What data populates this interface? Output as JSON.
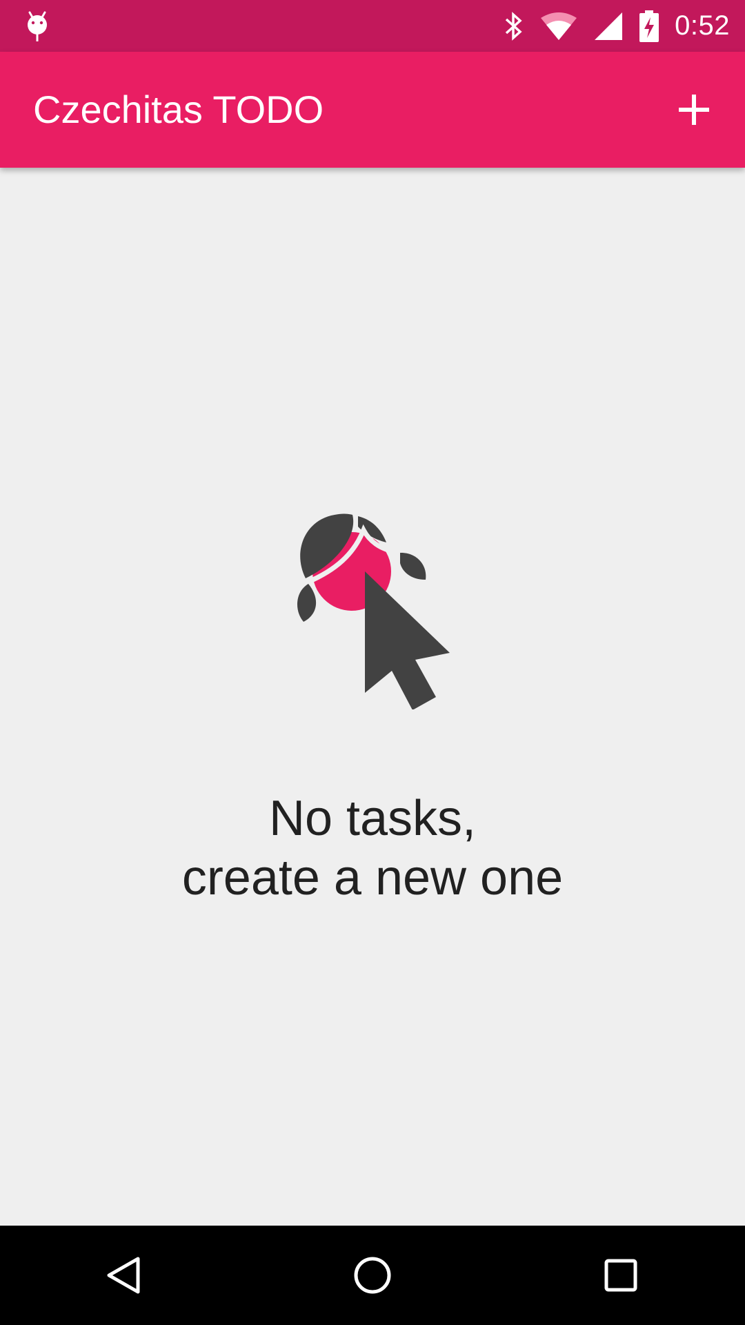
{
  "status_bar": {
    "time": "0:52",
    "icons": [
      "android-debug-icon",
      "bluetooth-icon",
      "wifi-icon",
      "cell-signal-icon",
      "battery-charging-icon"
    ]
  },
  "app_bar": {
    "title": "Czechitas TODO",
    "add_icon": "plus-icon"
  },
  "empty_state": {
    "illustration": "czechitas-logo-cursor",
    "line1": "No tasks,",
    "line2": "create a new one"
  },
  "nav_bar": {
    "icons": [
      "back-icon",
      "home-icon",
      "recents-icon"
    ]
  },
  "colors": {
    "status_bar": "#c2185b",
    "app_bar": "#e91e63",
    "background": "#efefef",
    "logo_dark": "#424242",
    "logo_accent": "#e91e63",
    "nav_bar": "#000000"
  }
}
